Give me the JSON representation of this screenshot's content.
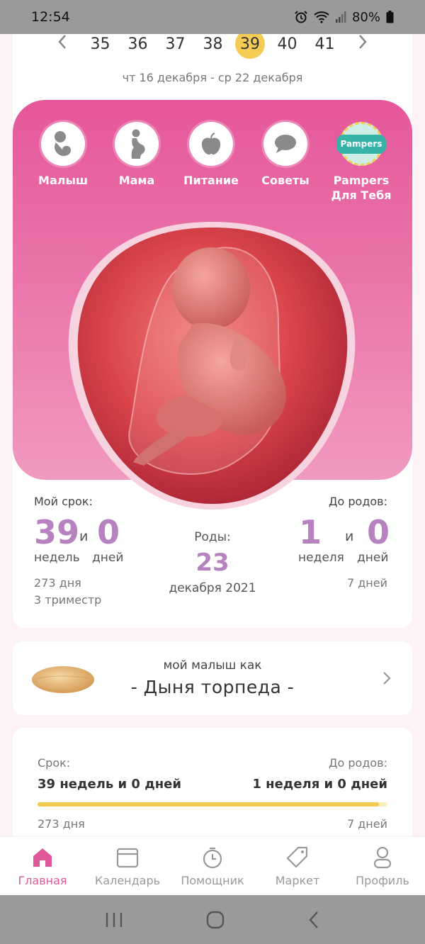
{
  "status": {
    "time": "12:54",
    "battery": "80%"
  },
  "weeks": {
    "prev_icon": "chevron-left-icon",
    "next_icon": "chevron-right-icon",
    "items": [
      "35",
      "36",
      "37",
      "38",
      "39",
      "40",
      "41"
    ],
    "active": "39"
  },
  "date_range": "чт 16 декабря - ср 22 декабря",
  "categories": [
    {
      "label": "Малыш",
      "icon": "baby-icon"
    },
    {
      "label": "Мама",
      "icon": "pregnant-mother-icon"
    },
    {
      "label": "Питание",
      "icon": "apple-icon"
    },
    {
      "label": "Советы",
      "icon": "speech-bubble-icon"
    },
    {
      "label_line1": "Pampers",
      "label_line2": "Для Тебя",
      "icon": "pampers-logo-icon",
      "logo_text": "Pampers"
    }
  ],
  "term": {
    "label": "Мой срок:",
    "weeks": "39",
    "and": "и",
    "days": "0",
    "weeks_unit": "недель",
    "days_unit": "дней",
    "total_days": "273 дня",
    "trimester": "3 триместр"
  },
  "birth": {
    "label": "Роды:",
    "day": "23",
    "month_year": "декабря 2021"
  },
  "until": {
    "label": "До родов:",
    "weeks": "1",
    "and": "и",
    "days": "0",
    "weeks_unit": "неделя",
    "days_unit": "дней",
    "total_days": "7 дней"
  },
  "fruit": {
    "caption": "мой малыш как",
    "name": "- Дыня торпеда -"
  },
  "progress": {
    "term_label": "Срок:",
    "term_value": "39 недель и 0 дней",
    "until_label": "До родов:",
    "until_value": "1 неделя и 0 дней",
    "fraction": 0.975,
    "days_left": "273 дня",
    "days_right": "7 дней"
  },
  "nav": [
    {
      "label": "Главная",
      "icon": "home-icon",
      "active": true
    },
    {
      "label": "Календарь",
      "icon": "calendar-icon",
      "active": false
    },
    {
      "label": "Помощник",
      "icon": "stopwatch-icon",
      "active": false
    },
    {
      "label": "Маркет",
      "icon": "tag-icon",
      "active": false
    },
    {
      "label": "Профиль",
      "icon": "profile-icon",
      "active": false
    }
  ],
  "colors": {
    "accent": "#e0589a",
    "number": "#b682bf",
    "highlight": "#f4cc53"
  }
}
